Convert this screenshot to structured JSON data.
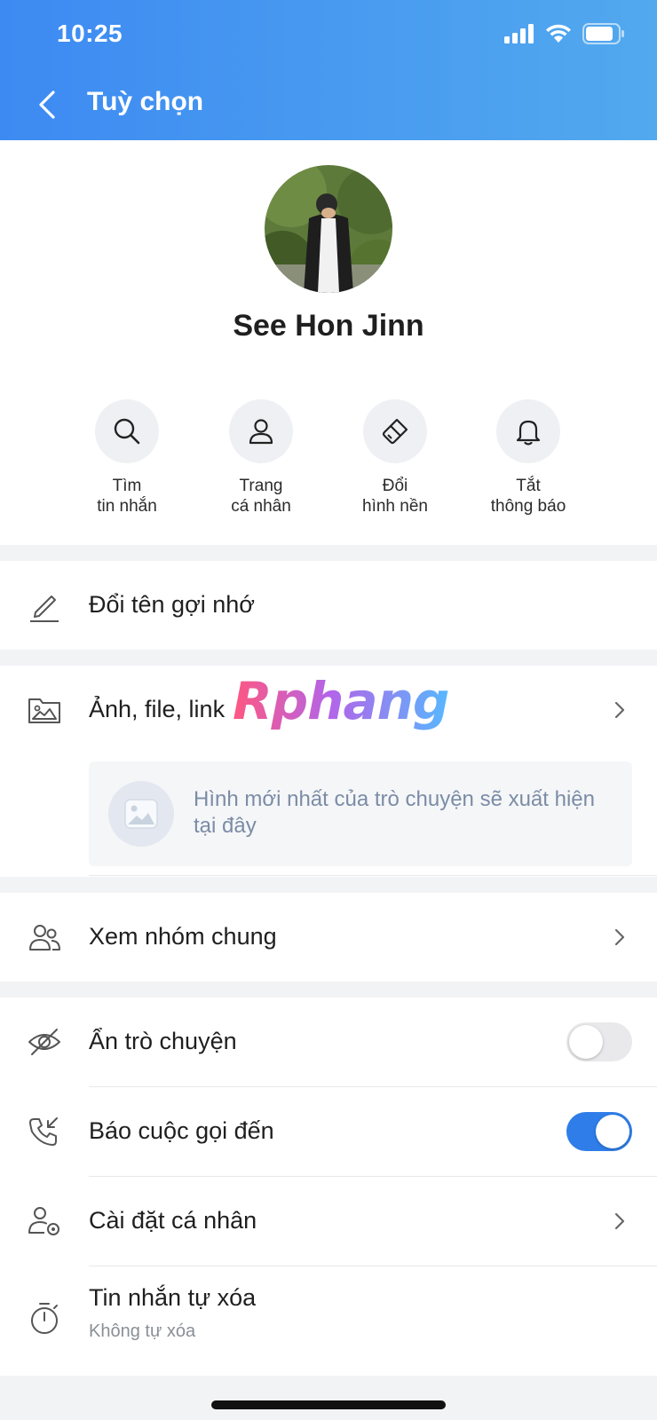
{
  "status_bar": {
    "time": "10:25"
  },
  "header": {
    "title": "Tuỳ chọn"
  },
  "profile": {
    "name": "See Hon Jinn"
  },
  "quick_actions": [
    {
      "line1": "Tìm",
      "line2": "tin nhắn",
      "icon": "search-icon"
    },
    {
      "line1": "Trang",
      "line2": "cá nhân",
      "icon": "user-icon"
    },
    {
      "line1": "Đổi",
      "line2": "hình nền",
      "icon": "paintbrush-icon"
    },
    {
      "line1": "Tắt",
      "line2": "thông báo",
      "icon": "bell-icon"
    }
  ],
  "rename": {
    "label": "Đổi tên gợi nhớ",
    "icon": "pencil-icon"
  },
  "media": {
    "label": "Ảnh, file, link",
    "icon": "folder-image-icon",
    "placeholder": "Hình mới nhất của trò chuyện sẽ xuất hiện tại đây",
    "watermark": "Rphang"
  },
  "groups": {
    "label": "Xem nhóm chung",
    "icon": "users-icon"
  },
  "settings": {
    "hide_chat": {
      "label": "Ẩn trò chuyện",
      "enabled": false,
      "icon": "eye-off-icon"
    },
    "call_alert": {
      "label": "Báo cuộc gọi đến",
      "enabled": true,
      "icon": "incoming-call-icon"
    },
    "personal": {
      "label": "Cài đặt cá nhân",
      "icon": "user-settings-icon"
    },
    "auto_delete": {
      "label": "Tin nhắn tự xóa",
      "sub": "Không tự xóa",
      "icon": "timer-icon"
    }
  },
  "colors": {
    "accent": "#3d8af2",
    "toggle_off": "#e9e9eb",
    "toggle_on": "#2f7de8"
  }
}
